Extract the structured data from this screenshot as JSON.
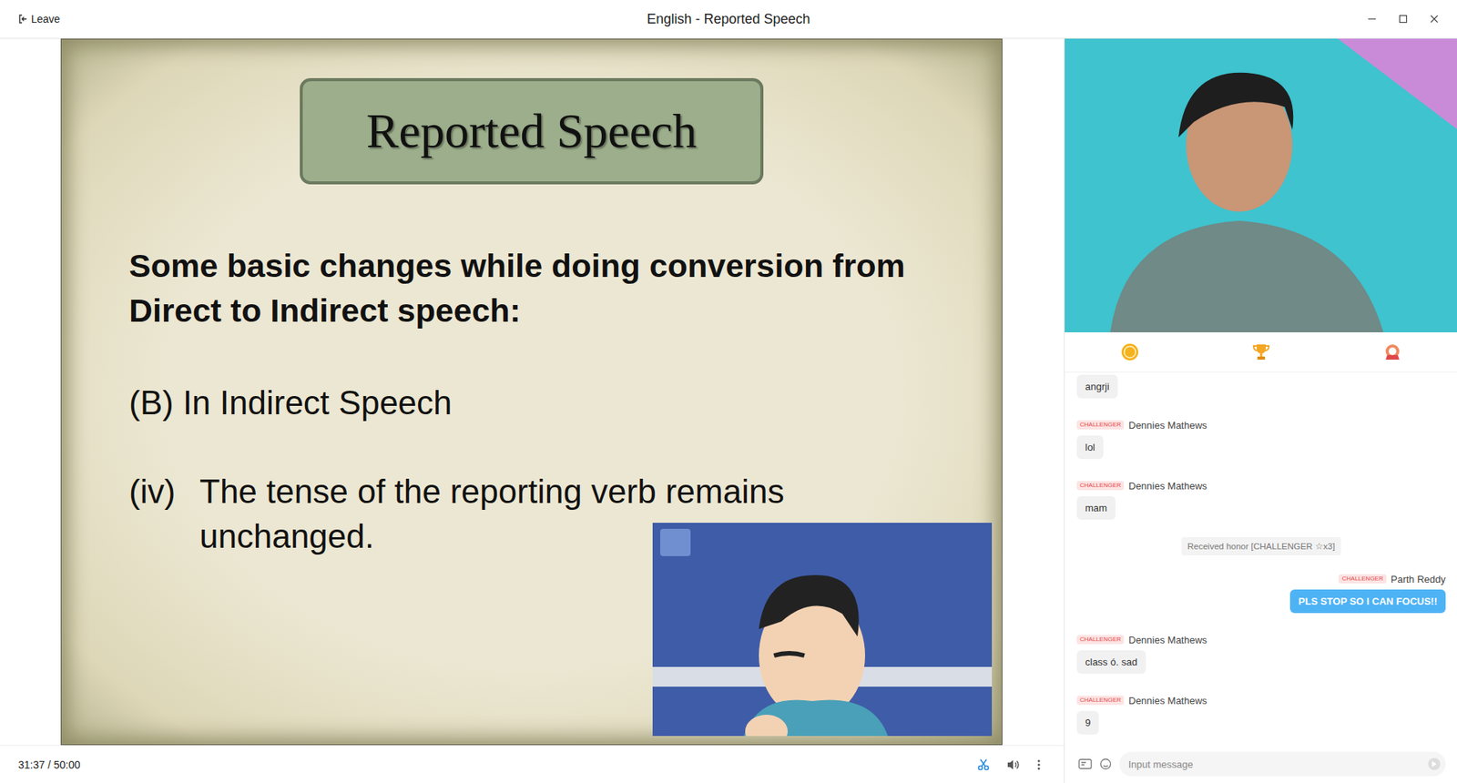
{
  "window": {
    "title": "English - Reported Speech",
    "leave": "Leave"
  },
  "slide": {
    "title": "Reported Speech",
    "heading": "Some basic changes while doing conversion from Direct to Indirect speech:",
    "section": "(B) In Indirect Speech",
    "point": {
      "number": "(iv)",
      "text": "The tense of the reporting verb remains unchanged."
    }
  },
  "player": {
    "time": "31:37 / 50:00"
  },
  "chat": {
    "messages": [
      {
        "kind": "message",
        "author": "",
        "badge": "",
        "text": "angrji",
        "self": false
      },
      {
        "kind": "message",
        "author": "Dennies Mathews",
        "badge": "CHALLENGER",
        "text": "lol",
        "self": false
      },
      {
        "kind": "message",
        "author": "Dennies Mathews",
        "badge": "CHALLENGER",
        "text": "mam",
        "self": false
      },
      {
        "kind": "system",
        "author": "",
        "badge": "",
        "text": "Received honor [CHALLENGER ☆x3]",
        "self": false
      },
      {
        "kind": "message",
        "author": "Parth Reddy",
        "badge": "CHALLENGER",
        "text": "PLS STOP SO I CAN FOCUS!!",
        "self": true
      },
      {
        "kind": "message",
        "author": "Dennies Mathews",
        "badge": "CHALLENGER",
        "text": "class ó. sad",
        "self": false
      },
      {
        "kind": "message",
        "author": "Dennies Mathews",
        "badge": "CHALLENGER",
        "text": "9",
        "self": false
      }
    ],
    "input": {
      "placeholder": "Input message"
    }
  }
}
